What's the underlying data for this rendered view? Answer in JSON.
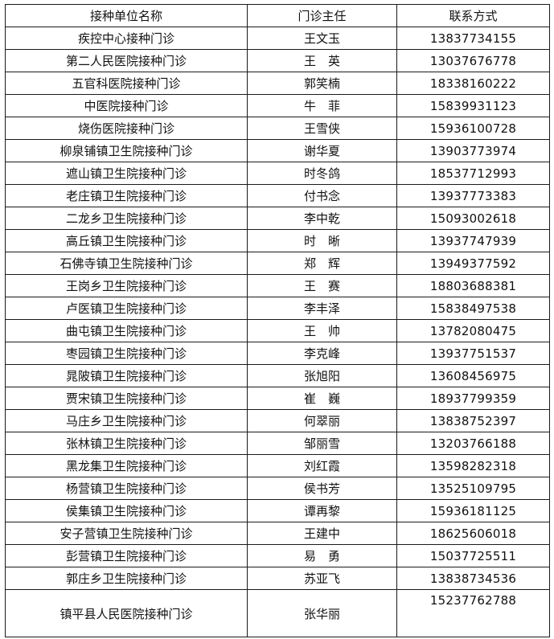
{
  "table": {
    "headers": [
      "接种单位名称",
      "门诊主任",
      "联系方式"
    ],
    "rows": [
      {
        "unit": "疾控中心接种门诊",
        "director": "王文玉",
        "phone": "13837734155"
      },
      {
        "unit": "第二人民医院接种门诊",
        "director": "王　英",
        "phone": "13037676778"
      },
      {
        "unit": "五官科医院接种门诊",
        "director": "郭笑楠",
        "phone": "18338160222"
      },
      {
        "unit": "中医院接种门诊",
        "director": "牛　菲",
        "phone": "15839931123"
      },
      {
        "unit": "烧伤医院接种门诊",
        "director": "王雪侠",
        "phone": "15936100728"
      },
      {
        "unit": "柳泉铺镇卫生院接种门诊",
        "director": "谢华夏",
        "phone": "13903773974"
      },
      {
        "unit": "遮山镇卫生院接种门诊",
        "director": "时冬鸽",
        "phone": "18537712993"
      },
      {
        "unit": "老庄镇卫生院接种门诊",
        "director": "付书念",
        "phone": "13937773383"
      },
      {
        "unit": "二龙乡卫生院接种门诊",
        "director": "李中乾",
        "phone": "15093002618"
      },
      {
        "unit": "高丘镇卫生院接种门诊",
        "director": "时　晰",
        "phone": "13937747939"
      },
      {
        "unit": "石佛寺镇卫生院接种门诊",
        "director": "郑　辉",
        "phone": "13949377592"
      },
      {
        "unit": "王岗乡卫生院接种门诊",
        "director": "王　赛",
        "phone": "18803688381"
      },
      {
        "unit": "卢医镇卫生院接种门诊",
        "director": "李丰泽",
        "phone": "15838497538"
      },
      {
        "unit": "曲屯镇卫生院接种门诊",
        "director": "王　帅",
        "phone": "13782080475"
      },
      {
        "unit": "枣园镇卫生院接种门诊",
        "director": "李克峰",
        "phone": "13937751537"
      },
      {
        "unit": "晁陂镇卫生院接种门诊",
        "director": "张旭阳",
        "phone": "13608456975"
      },
      {
        "unit": "贾宋镇卫生院接种门诊",
        "director": "崔　巍",
        "phone": "18937799359"
      },
      {
        "unit": "马庄乡卫生院接种门诊",
        "director": "何翠丽",
        "phone": "13838752397"
      },
      {
        "unit": "张林镇卫生院接种门诊",
        "director": "邹丽雪",
        "phone": "13203766188"
      },
      {
        "unit": "黑龙集卫生院接种门诊",
        "director": "刘红霞",
        "phone": "13598282318"
      },
      {
        "unit": "杨营镇卫生院接种门诊",
        "director": "侯书芳",
        "phone": "13525109795"
      },
      {
        "unit": "侯集镇卫生院接种门诊",
        "director": "谭再黎",
        "phone": "15936181125"
      },
      {
        "unit": "安子营镇卫生院接种门诊",
        "director": "王建中",
        "phone": "18625606018"
      },
      {
        "unit": "彭营镇卫生院接种门诊",
        "director": "易　勇",
        "phone": "15037725511"
      },
      {
        "unit": "郭庄乡卫生院接种门诊",
        "director": "苏亚飞",
        "phone": "13838734536"
      },
      {
        "unit": "镇平县人民医院接种门诊",
        "director": "张华丽",
        "phone": "15237762788"
      }
    ]
  }
}
